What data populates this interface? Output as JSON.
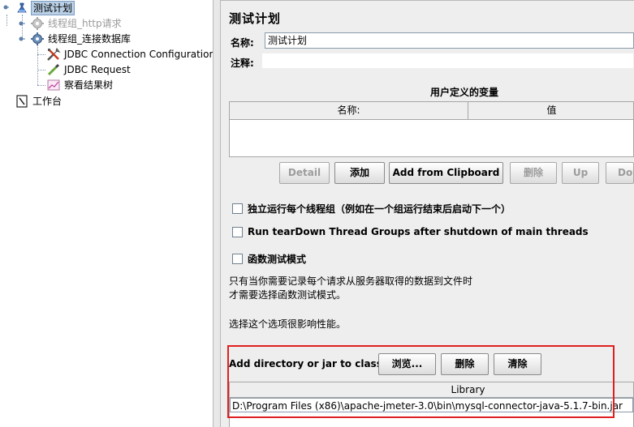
{
  "tree": {
    "items": [
      {
        "label": "测试计划",
        "icon": "test-plan-icon",
        "selected": true
      },
      {
        "label": "线程组_http请求",
        "icon": "gear-icon",
        "disabled": true
      },
      {
        "label": "线程组_连接数据库",
        "icon": "gear-icon"
      },
      {
        "label": "JDBC Connection Configuration",
        "icon": "tools-icon"
      },
      {
        "label": "JDBC Request",
        "icon": "pipette-icon"
      },
      {
        "label": "察看结果树",
        "icon": "chart-icon"
      },
      {
        "label": "工作台",
        "icon": "clipboard-icon"
      }
    ]
  },
  "panel": {
    "title": "测试计划",
    "name_label": "名称:",
    "name_value": "测试计划",
    "comment_label": "注释:",
    "vars_title": "用户定义的变量",
    "vars_columns": [
      "名称:",
      "值"
    ],
    "buttons": {
      "detail": "Detail",
      "add": "添加",
      "add_clipboard": "Add from Clipboard",
      "delete": "删除",
      "up": "Up",
      "down": "Down"
    },
    "checkboxes": {
      "independent": "独立运行每个线程组（例如在一个组运行结束后启动下一个）",
      "teardown": "Run tearDown Thread Groups after shutdown of main threads",
      "functional": "函数测试模式"
    },
    "help_text": {
      "line1": "只有当你需要记录每个请求从服务器取得的数据到文件时",
      "line2": "才需要选择函数测试模式。",
      "line3": "选择这个选项很影响性能。"
    },
    "classpath": {
      "label": "Add directory or jar to classpath",
      "browse": "浏览...",
      "delete": "删除",
      "clear": "清除",
      "library_header": "Library",
      "entry": "D:\\Program Files (x86)\\apache-jmeter-3.0\\bin\\mysql-connector-java-5.1.7-bin.jar"
    }
  },
  "colors": {
    "highlight_border": "#e02020",
    "selected_bg": "#b8cfe5"
  }
}
